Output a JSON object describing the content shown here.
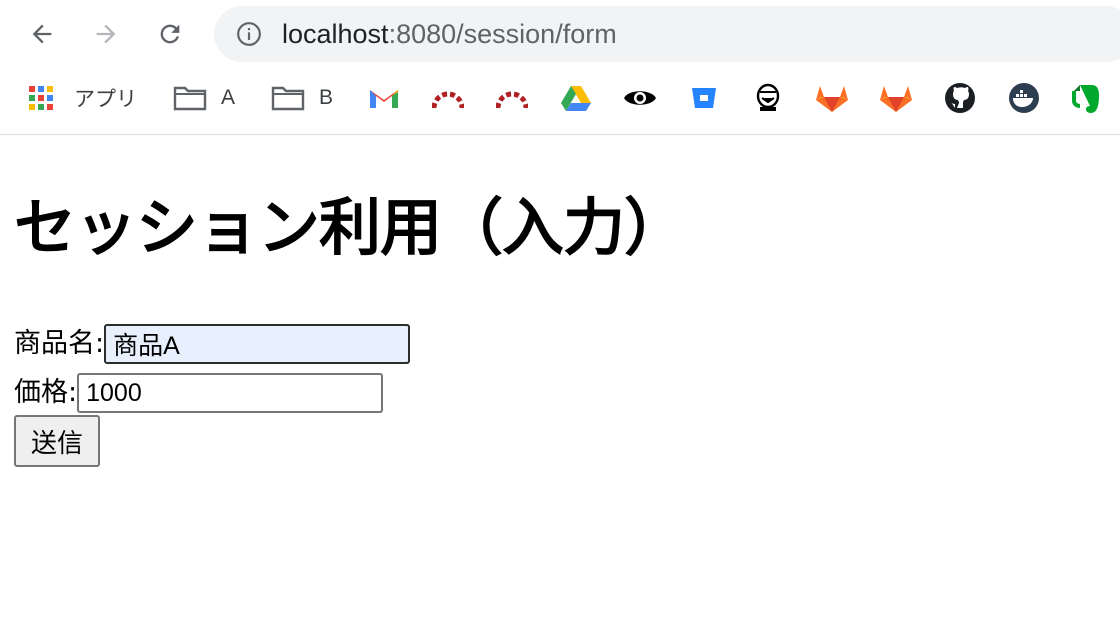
{
  "browser": {
    "url_host": "localhost",
    "url_path": ":8080/session/form",
    "bookmarks": {
      "apps_label": "アプリ",
      "folder_a_label": "A",
      "folder_b_label": "B"
    },
    "icons": [
      "back-arrow-icon",
      "forward-arrow-icon",
      "reload-icon",
      "info-icon",
      "apps-grid-icon",
      "folder-icon",
      "gmail-icon",
      "redmine-icon",
      "google-drive-icon",
      "eye-icon",
      "bitbucket-icon",
      "jenkins-icon",
      "gitlab-icon",
      "github-icon",
      "docker-icon",
      "evernote-icon"
    ]
  },
  "page": {
    "title": "セッション利用（入力）",
    "form": {
      "name_label": "商品名:",
      "name_value": "商品A",
      "price_label": "価格:",
      "price_value": "1000",
      "submit_label": "送信"
    }
  }
}
